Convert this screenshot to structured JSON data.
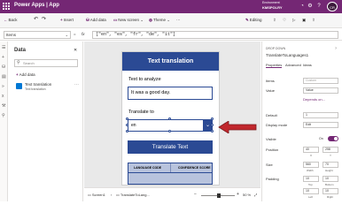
{
  "titlebar": {
    "app_name": "Power Apps  |  App",
    "env_label": "Environment",
    "env_name": "KMSPOLRY",
    "avatar_initials": "CR"
  },
  "commandbar": {
    "back": "Back",
    "undo": "↶",
    "redo": "↷",
    "insert": "Insert",
    "add_data": "Add data",
    "new_screen": "New screen",
    "theme": "Theme",
    "editing": "Editing"
  },
  "formulabar": {
    "property": "Items",
    "formula": "[\"en\", \"es\", \"fr\", \"de\", \"it\"]"
  },
  "datapanel": {
    "title": "Data",
    "search_placeholder": "Search",
    "add_data": "Add data",
    "source_name": "Text translation",
    "source_sub": "Text translation"
  },
  "screen": {
    "header": "Text translation",
    "analyze_label": "Text to analyze",
    "analyze_value": "It was a good day.",
    "translate_label": "Translate to",
    "dropdown_value": "en",
    "button": "Translate Text",
    "table_col1": "LANGUAGE CODE",
    "table_col2": "CONFIDENCE SCORE"
  },
  "statusbar": {
    "screen1": "Screen1",
    "control": "TranslateToLang...",
    "zoom": "50 %"
  },
  "props": {
    "type": "DROP DOWN",
    "name": "TranslateToLanguages1",
    "tabs": [
      "Properties",
      "Advanced",
      "Ideas"
    ],
    "items_label": "Items",
    "items_value": "Custom",
    "value_label": "Value",
    "value_value": "Value",
    "depends_on": "Depends on...",
    "default_label": "Default",
    "default_value": "1",
    "display_mode_label": "Display mode",
    "display_mode_value": "Edit",
    "visible_label": "Visible",
    "visible_state": "On",
    "position_label": "Position",
    "position_x": "40",
    "position_y": "258",
    "x_label": "X",
    "y_label": "Y",
    "size_label": "Size",
    "size_w": "560",
    "size_h": "70",
    "width_label": "Width",
    "height_label": "Height",
    "padding_label": "Padding",
    "pad_top": "10",
    "pad_bottom": "10",
    "pad_left": "10",
    "pad_right": "10",
    "top_label": "Top",
    "bottom_label": "Bottom",
    "left_label": "Left",
    "right_label": "Right"
  },
  "colors": {
    "brand": "#742774",
    "screen_blue": "#2b4a94",
    "arrow_red": "#c1272d"
  }
}
